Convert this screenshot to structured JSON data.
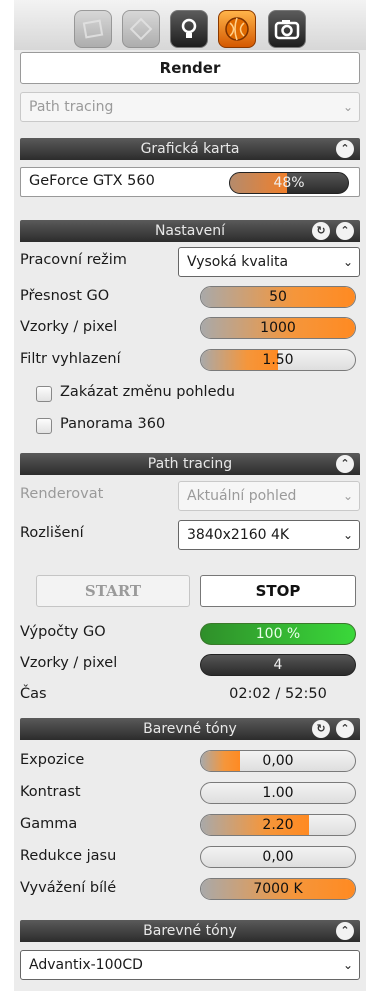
{
  "toolbar": {
    "icons": [
      "material-icon",
      "object-icon",
      "light-icon",
      "render-icon",
      "camera-icon"
    ],
    "title": "Render"
  },
  "mode_select": {
    "value": "Path tracing"
  },
  "graphics_card": {
    "title": "Grafická karta",
    "gpu_name": "GeForce GTX 560",
    "usage": "48%",
    "usage_fraction": 0.48
  },
  "settings": {
    "title": "Nastavení",
    "rows": [
      {
        "label": "Pracovní režim",
        "value": "Vysoká  kvalita"
      },
      {
        "label": "Přesnost GO",
        "value": "50",
        "fraction": 1.0
      },
      {
        "label": "Vzorky / pixel",
        "value": "1000",
        "fraction": 1.0
      },
      {
        "label": "Filtr vyhlazení",
        "value": "1.50",
        "fraction": 0.5
      }
    ],
    "checkboxes": [
      {
        "label": "Zakázat změnu pohledu",
        "checked": false
      },
      {
        "label": "Panorama 360",
        "checked": false
      }
    ]
  },
  "path_tracing": {
    "title": "Path tracing",
    "render_label": "Renderovat",
    "render_value": "Aktuální pohled",
    "resolution_label": "Rozlišení",
    "resolution_value": "3840x2160 4K",
    "start_label": "START",
    "stop_label": "STOP",
    "gi_label": "Výpočty GO",
    "gi_value": "100 %",
    "gi_fraction": 1.0,
    "samples_label": "Vzorky / pixel",
    "samples_value": "4",
    "time_label": "Čas",
    "time_value": "02:02 / 52:50"
  },
  "tone": {
    "title": "Barevné tóny",
    "rows": [
      {
        "label": "Expozice",
        "value": "0,00",
        "fraction": 0.25
      },
      {
        "label": "Kontrast",
        "value": "1.00",
        "fraction": 0
      },
      {
        "label": "Gamma",
        "value": "2.20",
        "fraction": 0.7
      },
      {
        "label": "Redukce jasu",
        "value": "0,00",
        "fraction": 0
      },
      {
        "label": "Vyvážení bílé",
        "value": "7000 K",
        "fraction": 1.0
      }
    ]
  },
  "tone_preset": {
    "title": "Barevné tóny",
    "value": "Advantix-100CD"
  },
  "colors": {
    "accent": "#f5963b",
    "header": "#3a3a3a",
    "green": "#3ad83a"
  }
}
